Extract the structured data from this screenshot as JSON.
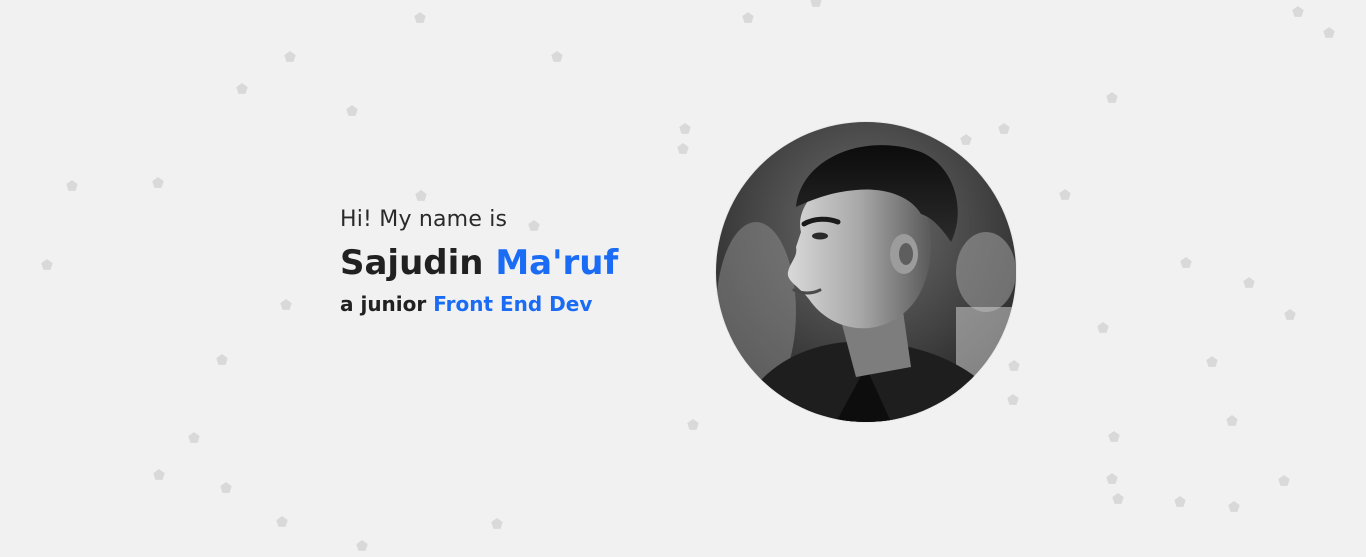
{
  "hero": {
    "greeting": "Hi! My name is",
    "first_name": "Sajudin",
    "last_name": "Ma'ruf",
    "role_prefix": "a junior",
    "role": "Front End Dev"
  },
  "avatar": {
    "alt": "Profile photo of Sajudin Ma'ruf"
  },
  "colors": {
    "background": "#f1f1f1",
    "text": "#212121",
    "accent": "#1a6cf5",
    "particle": "#d9d9d9"
  }
}
